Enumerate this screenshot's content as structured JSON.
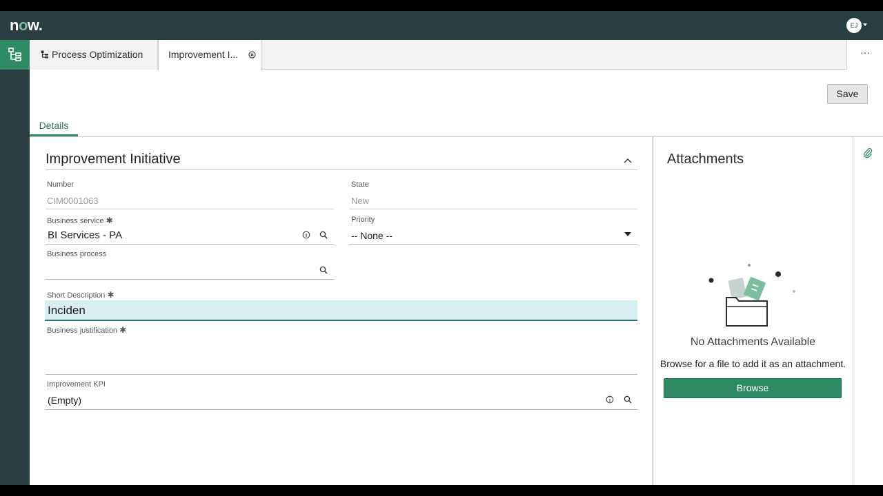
{
  "header": {
    "logo_prefix": "n",
    "logo_o": "o",
    "logo_suffix": "w.",
    "user_initials": "EJ"
  },
  "tabs": [
    {
      "label": "Process Optimization"
    },
    {
      "label": "Improvement I..."
    }
  ],
  "toolbar": {
    "save_label": "Save",
    "more_label": "···"
  },
  "form": {
    "details_tab": "Details",
    "section_title": "Improvement Initiative",
    "fields": {
      "number": {
        "label": "Number",
        "value": "CIM0001063"
      },
      "state": {
        "label": "State",
        "value": "New"
      },
      "business_service": {
        "label": "Business service",
        "value": "BI Services - PA"
      },
      "priority": {
        "label": "Priority",
        "value": "-- None --"
      },
      "business_process": {
        "label": "Business process",
        "value": ""
      },
      "short_description": {
        "label": "Short Description",
        "value": "Inciden"
      },
      "business_justification": {
        "label": "Business justification",
        "value": ""
      },
      "improvement_kpi": {
        "label": "Improvement KPI",
        "value": "(Empty)"
      }
    },
    "required_mark": "✱"
  },
  "attachments": {
    "title": "Attachments",
    "empty_title": "No Attachments Available",
    "empty_hint": "Browse for a file to add it as an attachment.",
    "browse_label": "Browse"
  },
  "colors": {
    "header": "#293e40",
    "accent": "#2e8b63",
    "active_field": "#d8eef0"
  }
}
